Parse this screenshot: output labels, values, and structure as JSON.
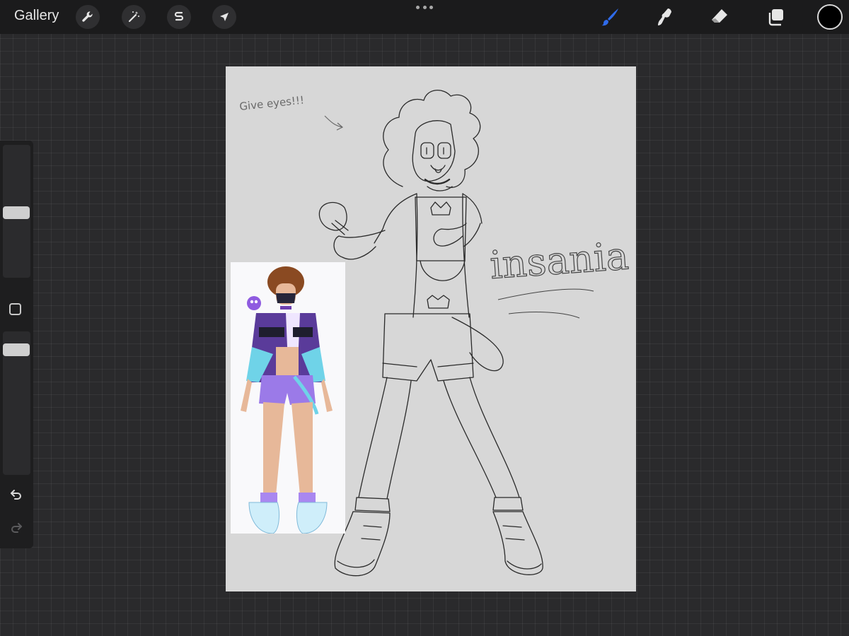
{
  "topbar": {
    "gallery_label": "Gallery",
    "left_tools": [
      {
        "name": "actions",
        "icon": "wrench-icon"
      },
      {
        "name": "adjustments",
        "icon": "magic-wand-icon"
      },
      {
        "name": "selection",
        "icon": "selection-s-icon"
      },
      {
        "name": "transform",
        "icon": "arrow-cursor-icon"
      }
    ],
    "right_tools": [
      {
        "name": "brush",
        "icon": "brush-icon",
        "active": true
      },
      {
        "name": "smudge",
        "icon": "smudge-icon"
      },
      {
        "name": "eraser",
        "icon": "eraser-icon"
      },
      {
        "name": "layers",
        "icon": "layers-icon"
      }
    ],
    "current_color": "#000000",
    "accent_color": "#2f6bea"
  },
  "sidebar": {
    "brush_size_level": 0.95,
    "opacity_level": 0.95,
    "undo_icon": "undo-icon",
    "redo_icon": "redo-icon"
  },
  "canvas": {
    "note_text": "Give eyes!!!",
    "signature_text": "insania",
    "reference_image": "character-reference-photo"
  }
}
